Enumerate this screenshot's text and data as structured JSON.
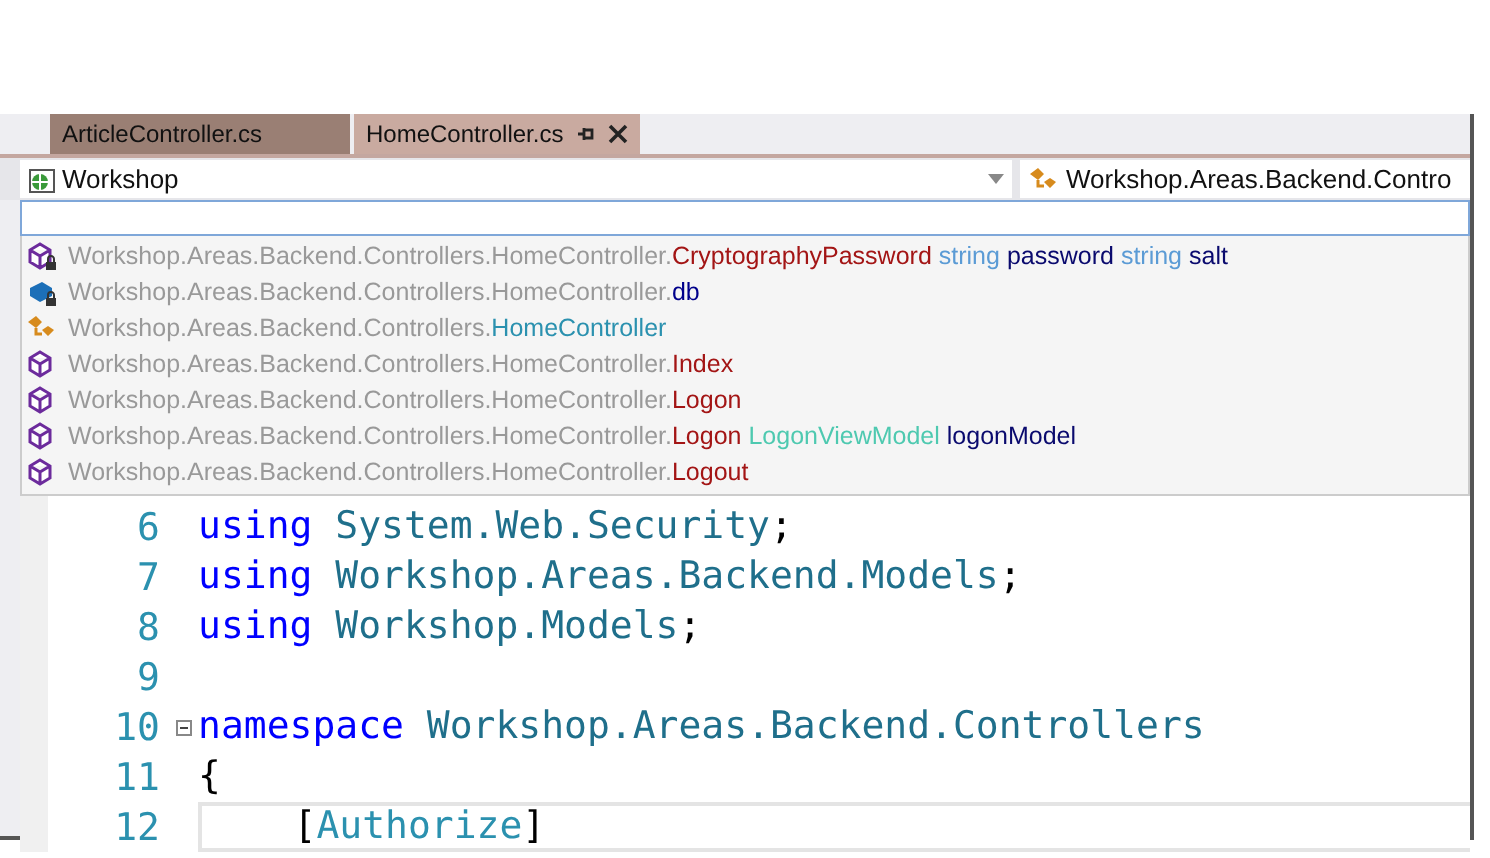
{
  "tabs": [
    {
      "label": "ArticleController.cs",
      "selected": false
    },
    {
      "label": "HomeController.cs",
      "selected": true
    }
  ],
  "navigation": {
    "project": "Workshop",
    "type": "Workshop.Areas.Backend.Contro"
  },
  "members": [
    {
      "kind": "method",
      "locked": true,
      "prefix": "Workshop.Areas.Backend.Controllers.HomeController.",
      "name": "CryptographyPassword",
      "params": [
        {
          "type": "string",
          "kind": "keyword",
          "name": "password"
        },
        {
          "type": "string",
          "kind": "keyword",
          "name": "salt"
        }
      ]
    },
    {
      "kind": "field",
      "locked": true,
      "prefix": "Workshop.Areas.Backend.Controllers.HomeController.",
      "name": "db"
    },
    {
      "kind": "class",
      "locked": false,
      "prefix": "Workshop.Areas.Backend.Controllers.",
      "name": "HomeController"
    },
    {
      "kind": "method",
      "locked": false,
      "prefix": "Workshop.Areas.Backend.Controllers.HomeController.",
      "name": "Index"
    },
    {
      "kind": "method",
      "locked": false,
      "prefix": "Workshop.Areas.Backend.Controllers.HomeController.",
      "name": "Logon"
    },
    {
      "kind": "method",
      "locked": false,
      "prefix": "Workshop.Areas.Backend.Controllers.HomeController.",
      "name": "Logon",
      "params": [
        {
          "type": "LogonViewModel",
          "kind": "class",
          "name": "logonModel"
        }
      ]
    },
    {
      "kind": "method",
      "locked": false,
      "prefix": "Workshop.Areas.Backend.Controllers.HomeController.",
      "name": "Logout"
    }
  ],
  "code": [
    {
      "number": "6",
      "fold": false,
      "current": false,
      "tokens": [
        {
          "text": "using",
          "kind": "keyword"
        },
        {
          "text": " System.Web.Security",
          "kind": "name"
        },
        {
          "text": ";",
          "kind": "plain"
        }
      ]
    },
    {
      "number": "7",
      "fold": false,
      "current": false,
      "tokens": [
        {
          "text": "using",
          "kind": "keyword"
        },
        {
          "text": " Workshop.Areas.Backend.Models",
          "kind": "name"
        },
        {
          "text": ";",
          "kind": "plain"
        }
      ]
    },
    {
      "number": "8",
      "fold": false,
      "current": false,
      "tokens": [
        {
          "text": "using",
          "kind": "keyword"
        },
        {
          "text": " Workshop.Models",
          "kind": "name"
        },
        {
          "text": ";",
          "kind": "plain"
        }
      ]
    },
    {
      "number": "9",
      "fold": false,
      "current": false
    },
    {
      "number": "10",
      "fold": true,
      "current": false,
      "tokens": [
        {
          "text": "namespace",
          "kind": "keyword"
        },
        {
          "text": " Workshop.Areas.Backend.Controllers",
          "kind": "name"
        }
      ]
    },
    {
      "number": "11",
      "fold": false,
      "current": false,
      "tokens": [
        {
          "text": "{",
          "kind": "plain"
        }
      ]
    },
    {
      "number": "12",
      "fold": false,
      "current": true,
      "tokens": [
        {
          "text": "    [",
          "kind": "plain"
        },
        {
          "text": "Authorize",
          "kind": "class"
        },
        {
          "text": "]",
          "kind": "plain"
        }
      ]
    }
  ]
}
